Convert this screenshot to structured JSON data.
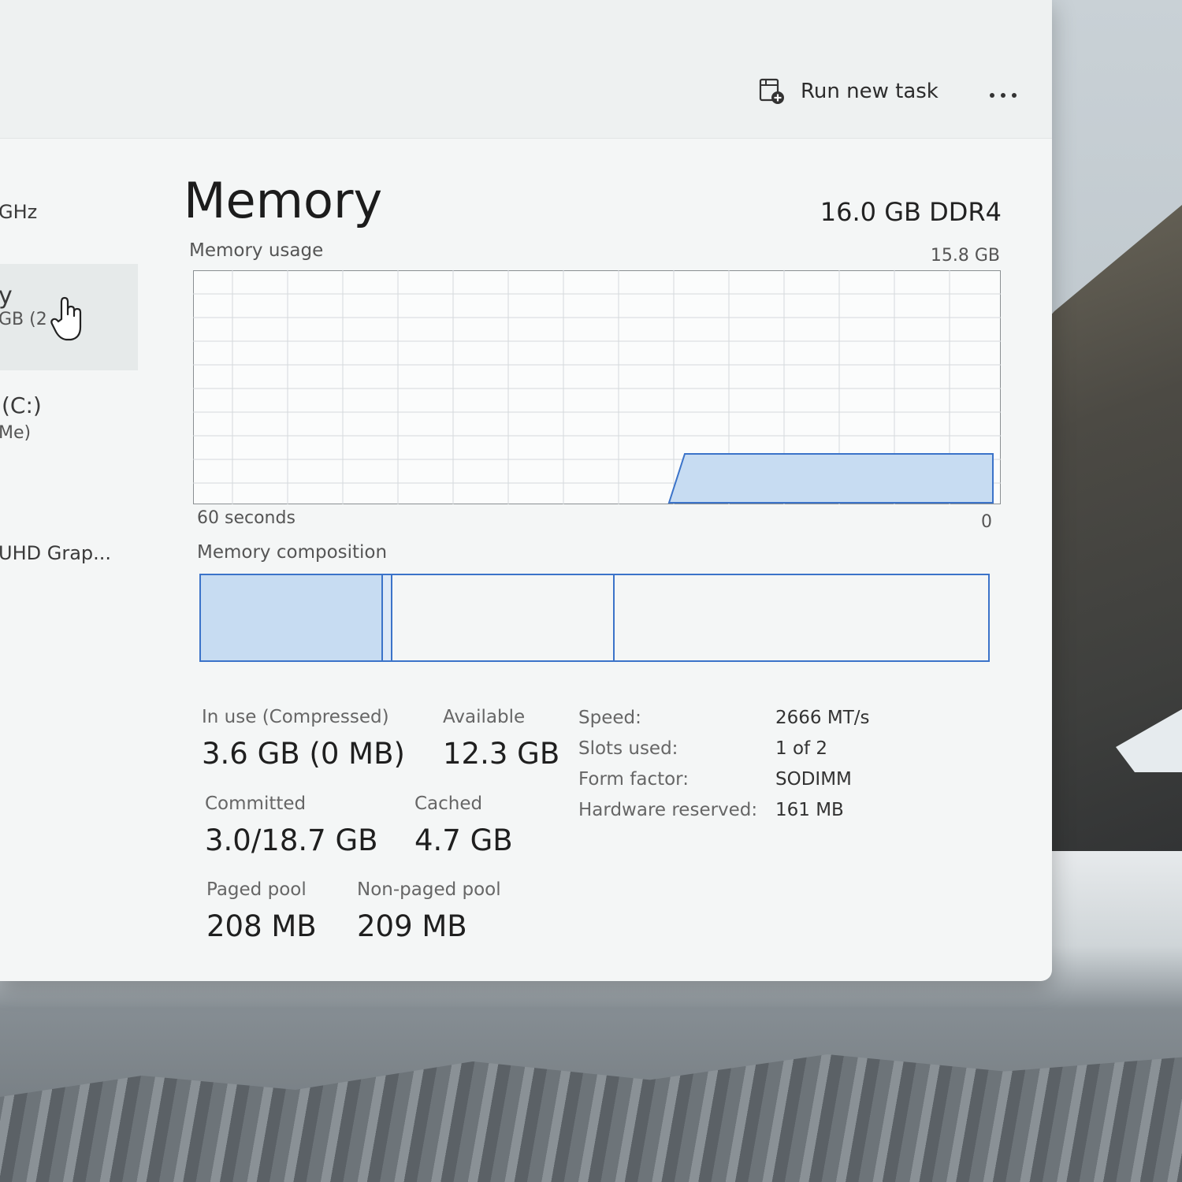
{
  "toolbar": {
    "run_new_task": "Run new task",
    "run_new_task_icon": "run-task-icon",
    "more_icon": "more-icon"
  },
  "sidebar": {
    "items": [
      {
        "label": "GHz",
        "sub": ""
      },
      {
        "label": "y",
        "sub": "GB (2"
      },
      {
        "label": "(C:)",
        "sub": "Me)"
      },
      {
        "label": "UHD Grap...",
        "sub": ""
      }
    ]
  },
  "memory": {
    "title": "Memory",
    "spec": "16.0 GB DDR4",
    "usage_label": "Memory usage",
    "usage_max": "15.8 GB",
    "graph_left": "60 seconds",
    "graph_right": "0",
    "composition_label": "Memory composition",
    "in_use_label": "In use (Compressed)",
    "in_use_value": "3.6 GB (0 MB)",
    "available_label": "Available",
    "available_value": "12.3 GB",
    "committed_label": "Committed",
    "committed_value": "3.0/18.7 GB",
    "cached_label": "Cached",
    "cached_value": "4.7 GB",
    "paged_label": "Paged pool",
    "paged_value": "208 MB",
    "nonpaged_label": "Non-paged pool",
    "nonpaged_value": "209 MB",
    "specs": [
      {
        "label": "Speed:",
        "value": "2666 MT/s"
      },
      {
        "label": "Slots used:",
        "value": "1 of 2"
      },
      {
        "label": "Form factor:",
        "value": "SODIMM"
      },
      {
        "label": "Hardware reserved:",
        "value": "161 MB"
      }
    ]
  },
  "colors": {
    "accent": "#3b73c9",
    "graph_fill": "#c7dcf2"
  }
}
